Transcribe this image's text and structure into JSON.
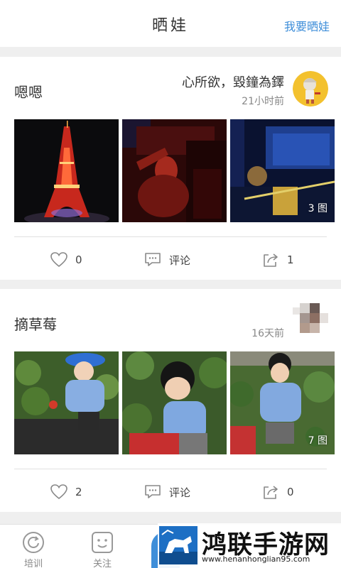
{
  "header": {
    "title": "晒娃",
    "action_label": "我要晒娃"
  },
  "posts": [
    {
      "title": "嗯嗯",
      "author": "心所欲，毀鐘為鐸",
      "time": "21小时前",
      "photo_count_label": "3 图",
      "likes": "0",
      "comment_label": "评论",
      "shares": "1"
    },
    {
      "title": "摘草莓",
      "author": "",
      "time": "16天前",
      "photo_count_label": "7 图",
      "likes": "2",
      "comment_label": "评论",
      "shares": "0"
    }
  ],
  "tabbar": {
    "training_label": "培训",
    "follow_label": "关注"
  },
  "watermark": {
    "name": "鸿联手游网",
    "url": "www.henanhonglian95.com"
  },
  "icons": {
    "like": "heart-outline-icon",
    "comment": "speech-bubble-icon",
    "share": "share-arrow-icon"
  },
  "colors": {
    "accent": "#3e8ed9",
    "background": "#efefef",
    "card": "#ffffff"
  }
}
